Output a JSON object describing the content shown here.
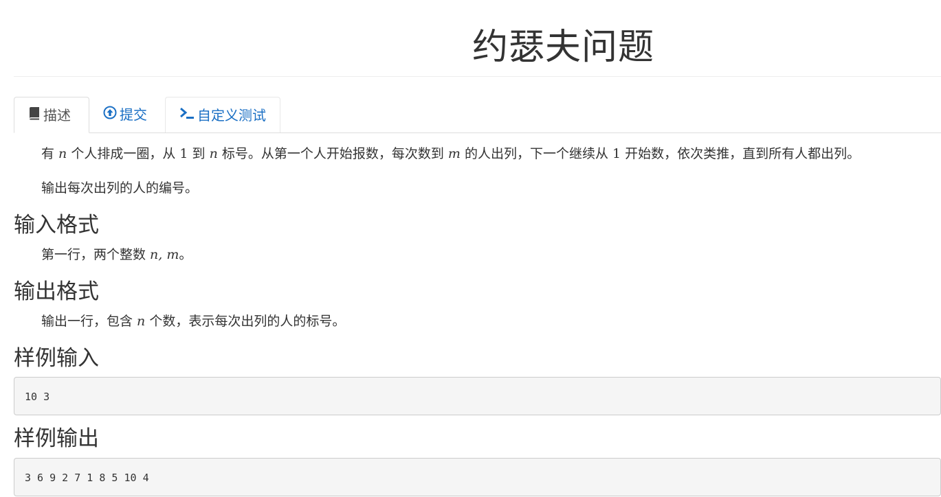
{
  "problem": {
    "title": "约瑟夫问题"
  },
  "tabs": [
    {
      "label": "描述",
      "icon": "book-icon",
      "active": true
    },
    {
      "label": "提交",
      "icon": "upload-circle-icon",
      "active": false
    },
    {
      "label": "自定义测试",
      "icon": "terminal-icon",
      "active": false
    }
  ],
  "description": {
    "p1": {
      "t1": "有 ",
      "v1": "n",
      "t2": " 个人排成一圈，从 ",
      "v2": "1",
      "t3": " 到 ",
      "v3": "n",
      "t4": " 标号。从第一个人开始报数，每次数到 ",
      "v4": "m",
      "t5": " 的人出列，下一个继续从 ",
      "v5": "1",
      "t6": " 开始数，依次类推，直到所有人都出列。"
    },
    "p2": "输出每次出列的人的编号。"
  },
  "input_format": {
    "heading": "输入格式",
    "t1": "第一行，两个整数 ",
    "v1": "n, m",
    "t2": "。"
  },
  "output_format": {
    "heading": "输出格式",
    "t1": "输出一行，包含 ",
    "v1": "n",
    "t2": " 个数，表示每次出列的人的标号。"
  },
  "sample_input": {
    "heading": "样例输入",
    "content": "10 3"
  },
  "sample_output": {
    "heading": "样例输出",
    "content": "3 6 9 2 7 1 8 5 10 4"
  },
  "colors": {
    "link": "#1a6fc4",
    "text": "#333333",
    "pre_bg": "#f5f5f5"
  }
}
